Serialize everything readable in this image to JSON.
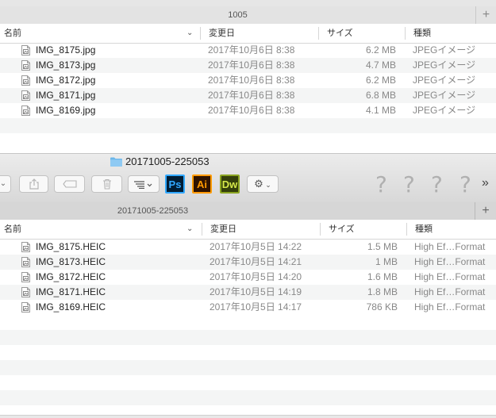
{
  "top_window": {
    "tab_title": "1005",
    "new_tab_symbol": "+",
    "columns": {
      "name": "名前",
      "date": "変更日",
      "size": "サイズ",
      "kind": "種類"
    },
    "rows": [
      {
        "name": "IMG_8175.jpg",
        "date": "2017年10月6日 8:38",
        "size": "6.2 MB",
        "kind": "JPEGイメージ"
      },
      {
        "name": "IMG_8173.jpg",
        "date": "2017年10月6日 8:38",
        "size": "4.7 MB",
        "kind": "JPEGイメージ"
      },
      {
        "name": "IMG_8172.jpg",
        "date": "2017年10月6日 8:38",
        "size": "6.2 MB",
        "kind": "JPEGイメージ"
      },
      {
        "name": "IMG_8171.jpg",
        "date": "2017年10月6日 8:38",
        "size": "6.8 MB",
        "kind": "JPEGイメージ"
      },
      {
        "name": "IMG_8169.jpg",
        "date": "2017年10月6日 8:38",
        "size": "4.1 MB",
        "kind": "JPEGイメージ"
      }
    ]
  },
  "bottom_window": {
    "window_title": "20171005-225053",
    "tab_title": "20171005-225053",
    "new_tab_symbol": "+",
    "toolbar": {
      "photoshop_label": "Ps",
      "illustrator_label": "Ai",
      "dreamweaver_label": "Dw",
      "unknown_item_symbol": "?",
      "overflow_symbol": "»"
    },
    "columns": {
      "name": "名前",
      "date": "変更日",
      "size": "サイズ",
      "kind": "種類"
    },
    "rows": [
      {
        "name": "IMG_8175.HEIC",
        "date": "2017年10月5日 14:22",
        "size": "1.5 MB",
        "kind": "High Ef…Format"
      },
      {
        "name": "IMG_8173.HEIC",
        "date": "2017年10月5日 14:21",
        "size": "1 MB",
        "kind": "High Ef…Format"
      },
      {
        "name": "IMG_8172.HEIC",
        "date": "2017年10月5日 14:20",
        "size": "1.6 MB",
        "kind": "High Ef…Format"
      },
      {
        "name": "IMG_8171.HEIC",
        "date": "2017年10月5日 14:19",
        "size": "1.8 MB",
        "kind": "High Ef…Format"
      },
      {
        "name": "IMG_8169.HEIC",
        "date": "2017年10月5日 14:17",
        "size": "786 KB",
        "kind": "High Ef…Format"
      }
    ]
  },
  "colors": {
    "photoshop": "#001d34",
    "illustrator": "#2f1300",
    "dreamweaver": "#35400b",
    "folder": "#6cb7ea"
  }
}
